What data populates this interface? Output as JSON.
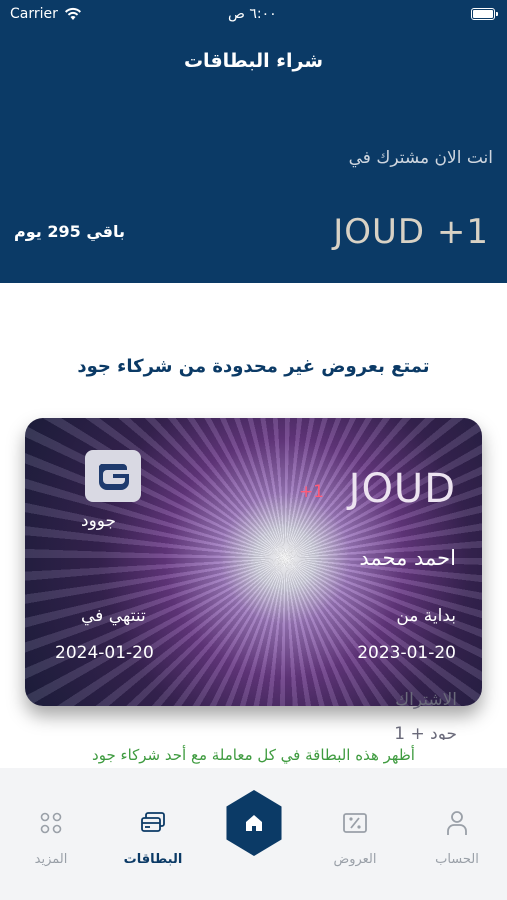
{
  "status": {
    "carrier": "Carrier",
    "time": "٦:٠٠ ص"
  },
  "header": {
    "title": "شراء البطاقات",
    "subscribed_label": "انت الان مشترك في",
    "plan_name": "JOUD +1",
    "days_left": "باقي 295 يوم"
  },
  "promo": "تمتع بعروض غير محدودة من شركاء جود",
  "card": {
    "logo_text": "جوود",
    "brand": "JOUD",
    "brand_plus": "+1",
    "holder": "احمد محمد",
    "start_label": "بداية من",
    "end_label": "تنتهي في",
    "start_date": "2023-01-20",
    "end_date": "2024-01-20",
    "subscription_label": "الاشتراك",
    "subscription_value": "جود + 1"
  },
  "hint": "أظهر هذه البطاقة في كل معاملة مع أحد شركاء جود",
  "tabs": [
    {
      "label": "الحساب",
      "icon": "person-icon"
    },
    {
      "label": "العروض",
      "icon": "discount-icon"
    },
    {
      "label": "",
      "icon": "home-icon"
    },
    {
      "label": "البطاقات",
      "icon": "cards-icon"
    },
    {
      "label": "المزيد",
      "icon": "grid-icon"
    }
  ],
  "colors": {
    "primary": "#0b3a66",
    "hint": "#3e9b3f",
    "plus": "#ff5a78"
  }
}
